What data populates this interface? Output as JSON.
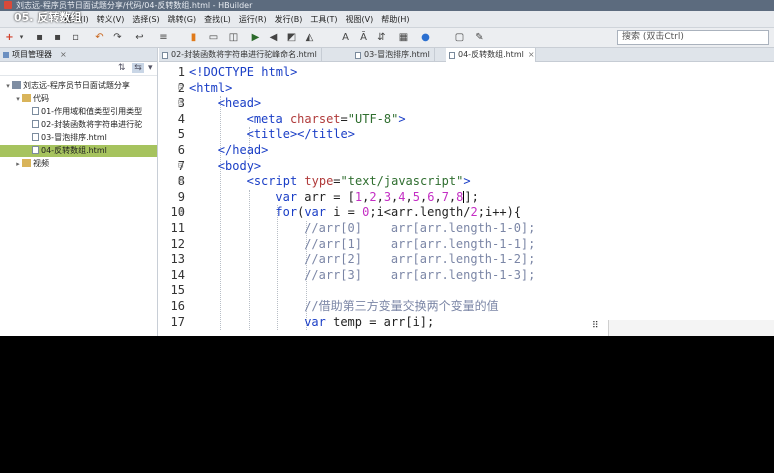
{
  "window": {
    "title": "刘志远-程序员节日面试题分享/代码/04-反转数组.html - HBuilder",
    "video_title": "05. 反转数组"
  },
  "menu": [
    "插入(I)",
    "转义(V)",
    "选择(S)",
    "跳转(G)",
    "查找(L)",
    "运行(R)",
    "发行(B)",
    "工具(T)",
    "视图(V)",
    "帮助(H)"
  ],
  "search": {
    "placeholder": "搜索 (双击Ctrl)"
  },
  "sidebar": {
    "title": "项目管理器",
    "items": [
      {
        "label": "刘志远-程序员节日面试题分享",
        "type": "project",
        "twist": "▾"
      },
      {
        "label": "代码",
        "type": "folder",
        "twist": "▾"
      },
      {
        "label": "01-作用域和值类型引用类型",
        "type": "file",
        "twist": ""
      },
      {
        "label": "02-封装函数将字符串进行驼",
        "type": "file",
        "twist": ""
      },
      {
        "label": "03-冒泡排序.html",
        "type": "file",
        "twist": ""
      },
      {
        "label": "04-反转数组.html",
        "type": "file",
        "twist": "",
        "selected": true
      },
      {
        "label": "视频",
        "type": "folder",
        "twist": "▸"
      }
    ]
  },
  "tabs": [
    {
      "label": "02-封装函数将字符串进行驼峰命名.html"
    },
    {
      "label": "03-冒泡排序.html"
    },
    {
      "label": "04-反转数组.html",
      "active": true
    }
  ],
  "editor": {
    "lines": [
      {
        "n": "1",
        "fold": "",
        "indent": 0,
        "tokens": [
          [
            "tag",
            "<!DOCTYPE html>"
          ]
        ]
      },
      {
        "n": "2",
        "fold": "⊟",
        "indent": 0,
        "tokens": [
          [
            "tag",
            "<html>"
          ]
        ]
      },
      {
        "n": "3",
        "fold": "⊟",
        "indent": 1,
        "tokens": [
          [
            "tag",
            "<head>"
          ]
        ]
      },
      {
        "n": "4",
        "fold": "",
        "indent": 2,
        "tokens": [
          [
            "tag",
            "<meta "
          ],
          [
            "attr",
            "charset"
          ],
          [
            "plain",
            "="
          ],
          [
            "str",
            "\"UTF-8\""
          ],
          [
            "tag",
            ">"
          ]
        ]
      },
      {
        "n": "5",
        "fold": "",
        "indent": 2,
        "tokens": [
          [
            "tag",
            "<title></title>"
          ]
        ]
      },
      {
        "n": "6",
        "fold": "",
        "indent": 1,
        "tokens": [
          [
            "tag",
            "</head>"
          ]
        ]
      },
      {
        "n": "7",
        "fold": "⊟",
        "indent": 1,
        "tokens": [
          [
            "tag",
            "<body>"
          ]
        ]
      },
      {
        "n": "8",
        "fold": "⊟",
        "indent": 2,
        "tokens": [
          [
            "tag",
            "<script "
          ],
          [
            "attr",
            "type"
          ],
          [
            "plain",
            "="
          ],
          [
            "str",
            "\"text/javascript\""
          ],
          [
            "tag",
            ">"
          ]
        ]
      },
      {
        "n": "9",
        "fold": "",
        "indent": 3,
        "tokens": [
          [
            "kw",
            "var "
          ],
          [
            "plain",
            "arr = ["
          ],
          [
            "num",
            "1"
          ],
          [
            "plain",
            ","
          ],
          [
            "num",
            "2"
          ],
          [
            "plain",
            ","
          ],
          [
            "num",
            "3"
          ],
          [
            "plain",
            ","
          ],
          [
            "num",
            "4"
          ],
          [
            "plain",
            ","
          ],
          [
            "num",
            "5"
          ],
          [
            "plain",
            ","
          ],
          [
            "num",
            "6"
          ],
          [
            "plain",
            ","
          ],
          [
            "num",
            "7"
          ],
          [
            "plain",
            ","
          ],
          [
            "num",
            "8"
          ],
          [
            "cursor",
            ""
          ],
          [
            "plain",
            "];"
          ]
        ]
      },
      {
        "n": "10",
        "fold": "⊟",
        "indent": 3,
        "tokens": [
          [
            "kw",
            "for"
          ],
          [
            "plain",
            "("
          ],
          [
            "kw",
            "var "
          ],
          [
            "plain",
            "i = "
          ],
          [
            "num",
            "0"
          ],
          [
            "plain",
            ";i<arr.length/"
          ],
          [
            "num",
            "2"
          ],
          [
            "plain",
            ";i++){"
          ]
        ]
      },
      {
        "n": "11",
        "fold": "",
        "indent": 4,
        "tokens": [
          [
            "cm",
            "//arr[0]    arr[arr.length-1-0];"
          ]
        ]
      },
      {
        "n": "12",
        "fold": "",
        "indent": 4,
        "tokens": [
          [
            "cm",
            "//arr[1]    arr[arr.length-1-1];"
          ]
        ]
      },
      {
        "n": "13",
        "fold": "",
        "indent": 4,
        "tokens": [
          [
            "cm",
            "//arr[2]    arr[arr.length-1-2];"
          ]
        ]
      },
      {
        "n": "14",
        "fold": "",
        "indent": 4,
        "tokens": [
          [
            "cm",
            "//arr[3]    arr[arr.length-1-3];"
          ]
        ]
      },
      {
        "n": "15",
        "fold": "",
        "indent": 4,
        "tokens": []
      },
      {
        "n": "16",
        "fold": "",
        "indent": 4,
        "tokens": [
          [
            "cm",
            "//借助第三方变量交换两个变量的值"
          ]
        ]
      },
      {
        "n": "17",
        "fold": "",
        "indent": 4,
        "tokens": [
          [
            "kw",
            "var "
          ],
          [
            "plain",
            "temp = arr[i];"
          ]
        ]
      }
    ]
  }
}
